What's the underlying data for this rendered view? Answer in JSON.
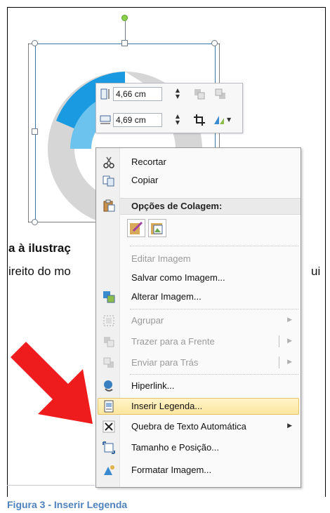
{
  "doc": {
    "heading_fragment": "a à ilustraç",
    "line_left": "ireito do mo",
    "line_right": "ui"
  },
  "size_toolbar": {
    "height_value": "4,66 cm",
    "width_value": "4,69 cm"
  },
  "menu": {
    "items": [
      {
        "label": "Recortar",
        "icon": "scissors-icon",
        "enabled": true
      },
      {
        "label": "Copiar",
        "icon": "copy-icon",
        "enabled": true
      },
      {
        "label": "Opções de Colagem:",
        "icon": "clipboard-icon",
        "enabled": true,
        "header": true
      },
      {
        "label": "Editar Imagem",
        "enabled": false
      },
      {
        "label": "Salvar como Imagem...",
        "enabled": true
      },
      {
        "label": "Alterar Imagem...",
        "icon": "change-picture-icon",
        "enabled": true
      },
      {
        "label": "Agrupar",
        "icon": "group-icon",
        "enabled": false,
        "submenu": true
      },
      {
        "label": "Trazer para a Frente",
        "icon": "bring-forward-icon",
        "enabled": false,
        "submenu": true
      },
      {
        "label": "Enviar para Trás",
        "icon": "send-backward-icon",
        "enabled": false,
        "submenu": true
      },
      {
        "label": "Hiperlink...",
        "icon": "hyperlink-icon",
        "enabled": true
      },
      {
        "label": "Inserir Legenda...",
        "icon": "insert-caption-icon",
        "enabled": true,
        "highlighted": true
      },
      {
        "label": "Quebra de Texto Automática",
        "icon": "text-wrap-icon",
        "enabled": true,
        "submenu": true
      },
      {
        "label": "Tamanho e Posição...",
        "icon": "size-position-icon",
        "enabled": true
      },
      {
        "label": "Formatar Imagem...",
        "icon": "format-picture-icon",
        "enabled": true
      }
    ]
  },
  "caption": "Figura 3 - Inserir Legenda",
  "colors": {
    "highlight": "#fde69f",
    "caption": "#4f81bd",
    "arrow": "#ee1c1c",
    "logo_blue": "#1a9ae0"
  }
}
